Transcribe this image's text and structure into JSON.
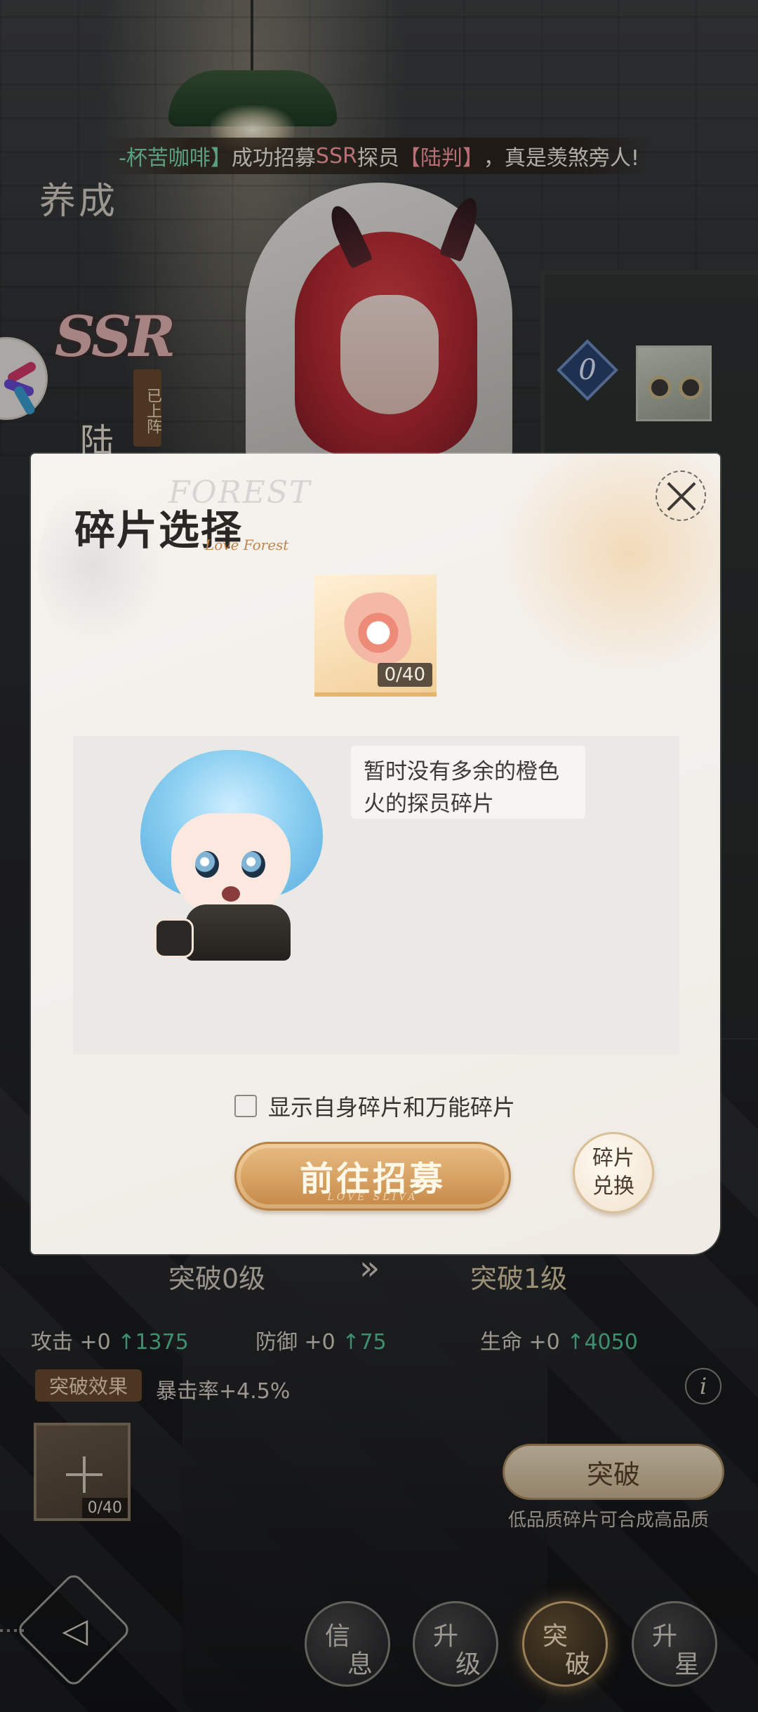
{
  "notice": {
    "prefix": "-杯苦咖啡】",
    "middle": "成功招募",
    "rarity": "SSR",
    "middle2": "探员",
    "agent": "【陆判】",
    "suffix": "，真是羡煞旁人!"
  },
  "page": {
    "title": "养成",
    "rarity": "SSR",
    "deployed_tag": "已上阵",
    "character_initial": "陆",
    "level_badge": "0"
  },
  "modal": {
    "title": "碎片选择",
    "watermark": "FOREST",
    "script_text": "Love Forest",
    "fragment_count": "0/40",
    "empty_message": "暂时没有多余的橙色火的探员碎片",
    "checkbox_label": "显示自身碎片和万能碎片",
    "recruit_button": "前往招募",
    "recruit_sub": "LOVE SLIVA",
    "exchange_button_line1": "碎片",
    "exchange_button_line2": "兑换"
  },
  "breakthrough": {
    "current": "突破0级",
    "arrow": "»",
    "next": "突破1级",
    "stats": [
      {
        "label": "攻击 +0",
        "gain": "↑1375"
      },
      {
        "label": "防御 +0",
        "gain": "↑75"
      },
      {
        "label": "生命 +0",
        "gain": "↑4050"
      }
    ],
    "effect_tag": "突破效果",
    "effect_text": "暴击率+4.5%",
    "info": "i",
    "slot_count": "0/40",
    "action_button": "突破",
    "hint": "低品质碎片可合成高品质"
  },
  "nav": {
    "back_icon": "◁",
    "items": [
      {
        "t1": "信",
        "t2": "息"
      },
      {
        "t1": "升",
        "t2": "级"
      },
      {
        "t1": "突",
        "t2": "破"
      },
      {
        "t1": "升",
        "t2": "星"
      }
    ]
  },
  "colors": {
    "accent_gold": "#d7a163",
    "stat_up_green": "#56c79a",
    "notice_name_green": "#7ee0b0",
    "notice_pink": "#ff9aa2"
  }
}
